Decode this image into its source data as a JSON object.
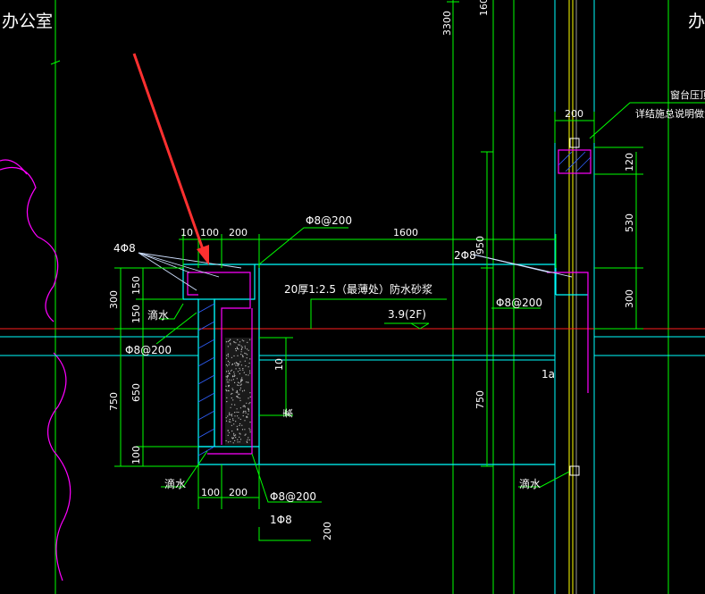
{
  "colors": {
    "background": "#000000",
    "dimension": "#00ff00",
    "outline": "#00ffff",
    "rebar": "#ff00ff",
    "leader": "#ffffff",
    "datum": "#ff0000",
    "arrow": "#ff3333",
    "text": "#ffffff"
  },
  "rooms": {
    "left": "办公室",
    "right": "办"
  },
  "top_dims": {
    "overall_height": "3300",
    "top_cut": "160"
  },
  "upper_dims": {
    "d10": "10",
    "d100": "100",
    "d200": "200",
    "d1600": "1600"
  },
  "left_dims": {
    "v300": "300",
    "v150a": "150",
    "v150b": "150",
    "v750": "750",
    "v650": "650",
    "v100": "100"
  },
  "mid_dims": {
    "v950": "950",
    "v750": "750",
    "v10": "10"
  },
  "right_dims": {
    "w200": "200",
    "v120": "120",
    "v530": "530",
    "v300": "300"
  },
  "bottom_dims": {
    "d100": "100",
    "d200": "200",
    "d200v": "200"
  },
  "labels": {
    "rebar_4phi8": "4Φ8",
    "rebar_2phi8": "2Φ8",
    "phi8_at200_top": "Φ8@200",
    "phi8_at200_mid": "Φ8@200",
    "phi8_at200_left": "Φ8@200",
    "phi8_at200_bottom": "Φ8@200",
    "rebar_1phi8": "1Φ8",
    "mortar": "20厚1:2.5（最薄处）防水砂浆",
    "elevation": "3.9(2F)",
    "drip_a": "滴水",
    "drip_b": "滴水",
    "drip_c": "滴水",
    "window_sill_a": "窗台压顶",
    "window_sill_b": "详结施总说明做法",
    "small_mark": "1a",
    "vertical_mark": "素"
  }
}
